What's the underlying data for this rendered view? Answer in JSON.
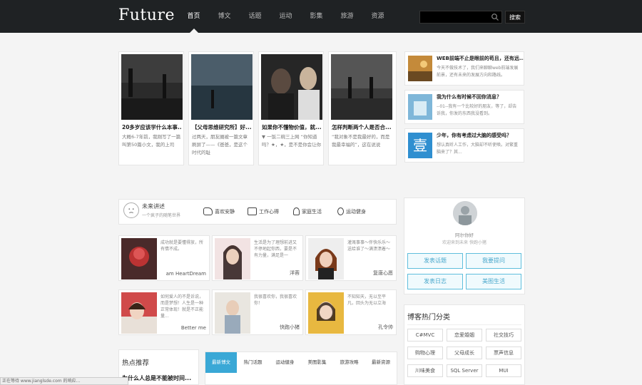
{
  "header": {
    "logo": "Future",
    "nav": [
      "首页",
      "博文",
      "话题",
      "运动",
      "影集",
      "旅游",
      "资源"
    ],
    "search_placeholder": "",
    "search_button": "搜索"
  },
  "featured": [
    {
      "title": "20多岁应该学什么本事...",
      "desc": "大概6-7年前，我刚写了一篇叫第50篇小文，我的上司"
    },
    {
      "title": "【父母思维研究所】好...",
      "desc": "过两天，朋友圈被一篇文章刷屏了——《爸爸，是这个时代的耻"
    },
    {
      "title": "如果你不懂物价值，就...",
      "desc": "▼ 一饭二碗三上网 “你知道吗？★，★，是不是你会让你"
    },
    {
      "title": "怎样判断两个人是否合...",
      "desc": "“我对象不是我最好的，而是我最幸福的”，这在说说"
    }
  ],
  "side_articles": [
    {
      "title": "WEB前端不止是眼前的苟且，还有远...",
      "desc": "今天不做技术了，我们来聊聊web前端发展前景，还有未来的发展方向和路线。"
    },
    {
      "title": "我为什么有时候不回你消息？",
      "desc": "--01--我有一个比较好的朋友，等了，却告诉我，你发的东西我没看到。"
    },
    {
      "title": "少年，你有考虑过大脑的感受吗？",
      "desc": "想认真听人工作，大脑却不听使唤。对繁重脑来了？其..."
    }
  ],
  "side_glyph": "壹",
  "strip": {
    "title": "未来讲述",
    "subtitle": "一个疯子的随笔世界",
    "tabs": [
      "喜欢安静",
      "工作心得",
      "家庭生活",
      "运动健身"
    ]
  },
  "users": [
    {
      "desc": "成功就是要懂得放，所有情不成。",
      "name": "am HeartDream"
    },
    {
      "desc": "生活是为了理想前进又不停地起你西，要是不有力量，满足是一",
      "name": "洋蓉"
    },
    {
      "desc": "灌溉事事～伴快乐乐～送给谁了～满溃溃着～",
      "name": "复唐心愿"
    },
    {
      "desc": "如何爱人的不是诉说，而是梦想！人生是一种正常体现！就是不正能量...",
      "name": "Better me"
    },
    {
      "desc": "我很喜欢你，我很喜欢你！",
      "name": "快跑小猪"
    },
    {
      "desc": "不知知天，无以至平凡，回头为无以立海",
      "name": "孔令帅"
    }
  ],
  "profile": {
    "name": "阿尔你好",
    "motto": "欢迎来到未来 快跑小猪",
    "buttons": [
      "发表话题",
      "我要提问",
      "发表日志",
      "美图生活"
    ]
  },
  "categories": {
    "title": "博客热门分类",
    "tags": [
      "C#MVC",
      "恋爱婚姻",
      "社交技巧",
      "购物心理",
      "父母成长",
      "票声信息",
      "川味美食",
      "SQL Server",
      "MUI"
    ]
  },
  "hot": {
    "title": "热点推荐",
    "item": "为什么人总是不能被时间..."
  },
  "bottom_tabs": [
    "最新博文",
    "热门话题",
    "运动健身",
    "美图影集",
    "旅游攻略",
    "最新资源"
  ],
  "status_text": "正在等待 www.jianglsde.com 的响应...",
  "colors": {
    "accent": "#3aa8d6",
    "header": "#1f2224"
  }
}
